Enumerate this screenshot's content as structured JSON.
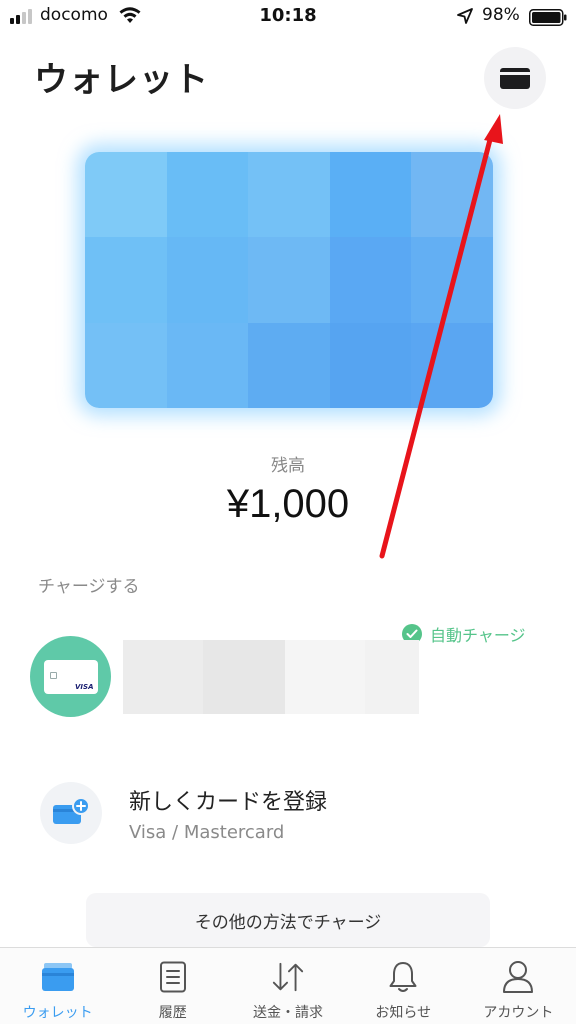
{
  "status_bar": {
    "carrier": "docomo",
    "time": "10:18",
    "battery_percent": "98%",
    "signal_bars": 2,
    "signal_bars_total": 4,
    "icons": [
      "signal-icon",
      "wifi-icon",
      "location-arrow-icon",
      "battery-icon"
    ]
  },
  "header": {
    "title": "ウォレット",
    "cards_button_icon": "card-icon"
  },
  "card": {
    "palette": [
      "#7fcaf7",
      "#69bdf6",
      "#74c1f6",
      "#5aaff5",
      "#72b7f3",
      "#6fc0f6",
      "#66b8f5",
      "#6eb9f4",
      "#5aa8f3",
      "#63aff3",
      "#74c0f6",
      "#6ab8f5",
      "#5eacf2",
      "#56a4f1",
      "#5aa6f2"
    ]
  },
  "balance": {
    "label": "残高",
    "amount": "¥1,000"
  },
  "charge": {
    "section_label": "チャージする",
    "auto_charge_label": "自動チャージ",
    "visa_brand_text": "VISA",
    "add_card": {
      "title": "新しくカードを登録",
      "subtitle": "Visa / Mastercard"
    },
    "other_methods_label": "その他の方法でチャージ"
  },
  "tabs": [
    {
      "label": "ウォレット",
      "icon": "wallet-icon",
      "active": true
    },
    {
      "label": "履歴",
      "icon": "document-icon",
      "active": false
    },
    {
      "label": "送金・請求",
      "icon": "transfer-arrows-icon",
      "active": false
    },
    {
      "label": "お知らせ",
      "icon": "bell-icon",
      "active": false
    },
    {
      "label": "アカウント",
      "icon": "person-icon",
      "active": false
    }
  ],
  "colors": {
    "accent": "#3a9cf0",
    "auto_charge_green": "#55c48a",
    "visa_avatar": "#5fc9a8",
    "annotation_red": "#e8141b"
  }
}
